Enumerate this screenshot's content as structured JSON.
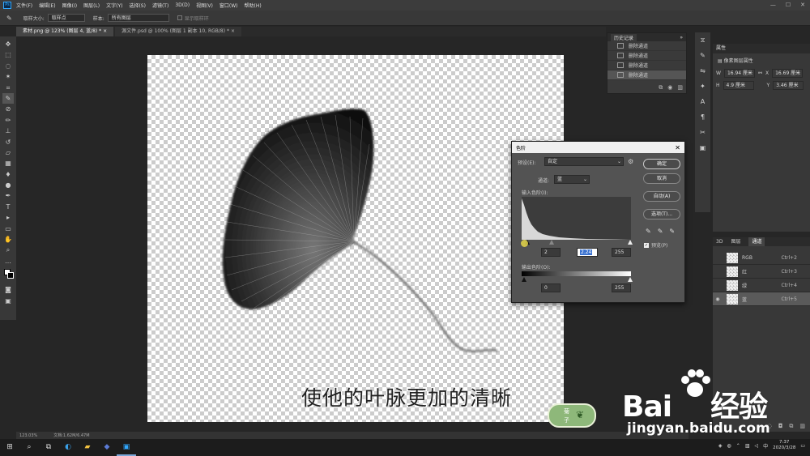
{
  "menubar": {
    "items": [
      "文件(F)",
      "编辑(E)",
      "图像(I)",
      "图层(L)",
      "文字(Y)",
      "选择(S)",
      "滤镜(T)",
      "3D(D)",
      "视图(V)",
      "窗口(W)",
      "帮助(H)"
    ]
  },
  "options": {
    "sample_size_label": "取样大小:",
    "sample_size_value": "取样点",
    "sample_label": "样本:",
    "sample_value": "所有图层",
    "show_ring_label": "显示取样环"
  },
  "tabs": [
    {
      "label": "素材.png @ 123% (图层 4, 蓝/8) *"
    },
    {
      "label": "源文件.psd @ 100% (图层 1 副本 10, RGB/8) *"
    }
  ],
  "subtitle": "使他的叶脉更加的清晰",
  "statusbar": {
    "zoom": "123.03%",
    "doc": "文档:1.62M/6.47M"
  },
  "history": {
    "title": "历史记录",
    "rows": [
      "删除通道",
      "删除通道",
      "删除通道",
      "删除通道"
    ]
  },
  "properties": {
    "title": "属性",
    "subtitle": "像素图层属性",
    "w": "16.94 厘米",
    "x": "16.69 厘米",
    "h": "4.9 厘米",
    "y": "3.46 厘米",
    "w_label": "W",
    "h_label": "H",
    "x_label": "X",
    "y_label": "Y"
  },
  "layers": {
    "tabs": [
      "3D",
      "图层",
      "通道"
    ],
    "rows": [
      {
        "name": "RGB",
        "shortcut": "Ctrl+2"
      },
      {
        "name": "红",
        "shortcut": "Ctrl+3"
      },
      {
        "name": "绿",
        "shortcut": "Ctrl+4"
      },
      {
        "name": "蓝",
        "shortcut": "Ctrl+5"
      }
    ]
  },
  "levels": {
    "title": "色阶",
    "preset_label": "预设(E):",
    "preset_value": "自定",
    "channel_label": "通道:",
    "channel_value": "蓝",
    "input_label": "输入色阶(I):",
    "output_label": "输出色阶(O):",
    "input_black": "2",
    "input_gamma": "2.24",
    "input_white": "255",
    "output_black": "0",
    "output_white": "255",
    "ok": "确定",
    "cancel": "取消",
    "auto": "自动(A)",
    "options": "选项(T)...",
    "preview": "预览(P)"
  },
  "taskbar": {
    "time": "7:37",
    "date": "2020/3/28"
  },
  "watermark": {
    "main": "Bai",
    "main2": "经验",
    "url": "jingyan.baidu.com"
  },
  "tag": {
    "line1": "菊",
    "line2": "子"
  }
}
